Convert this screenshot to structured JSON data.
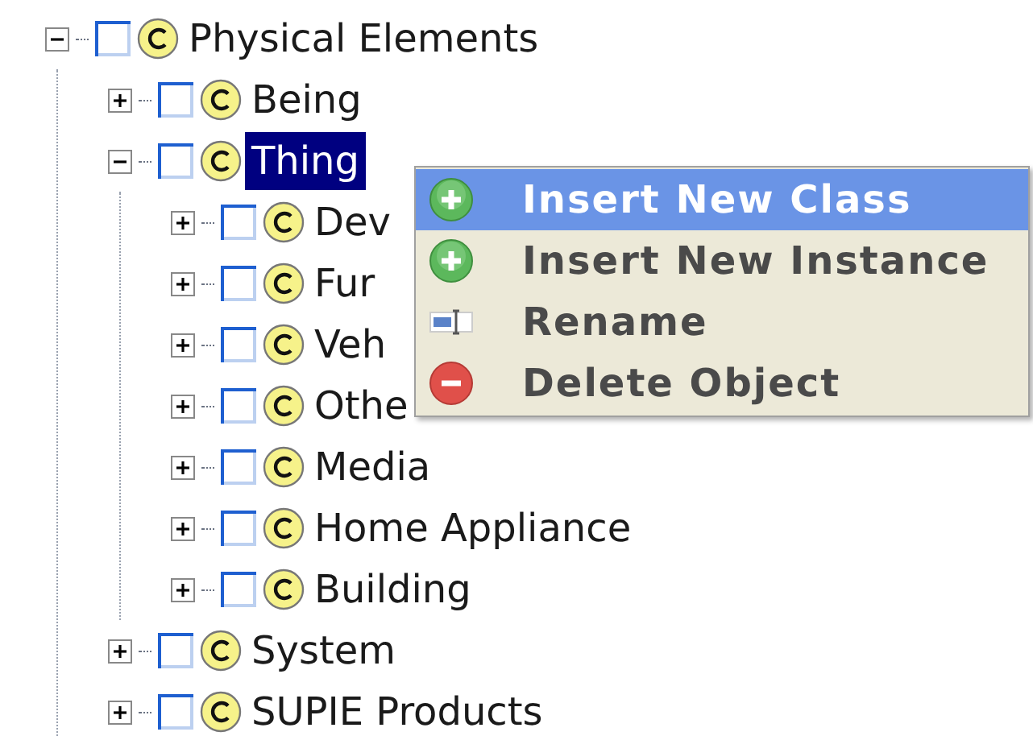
{
  "tree": [
    {
      "label": "Physical Elements",
      "expanded": true,
      "checked": false,
      "selected": false,
      "children": [
        {
          "label": "Being",
          "expanded": false,
          "checked": false,
          "selected": false
        },
        {
          "label": "Thing",
          "expanded": true,
          "checked": false,
          "selected": true,
          "children": [
            {
              "label": "Dev",
              "expanded": false,
              "checked": false,
              "selected": false
            },
            {
              "label": "Fur",
              "expanded": false,
              "checked": false,
              "selected": false
            },
            {
              "label": "Veh",
              "expanded": false,
              "checked": false,
              "selected": false
            },
            {
              "label": "Othe",
              "expanded": false,
              "checked": false,
              "selected": false
            },
            {
              "label": "Media",
              "expanded": false,
              "checked": false,
              "selected": false
            },
            {
              "label": "Home Appliance",
              "expanded": false,
              "checked": false,
              "selected": false
            },
            {
              "label": "Building",
              "expanded": false,
              "checked": false,
              "selected": false
            }
          ]
        },
        {
          "label": "System",
          "expanded": false,
          "checked": false,
          "selected": false
        },
        {
          "label": "SUPIE Products",
          "expanded": false,
          "checked": false,
          "selected": false
        }
      ]
    }
  ],
  "context_menu": {
    "items": [
      {
        "label": "Insert New Class",
        "kind": "add",
        "selected": true
      },
      {
        "label": "Insert New Instance",
        "kind": "add",
        "selected": false
      },
      {
        "label": "Rename",
        "kind": "rename",
        "selected": false
      },
      {
        "label": "Delete Object",
        "kind": "delete",
        "selected": false
      }
    ]
  }
}
